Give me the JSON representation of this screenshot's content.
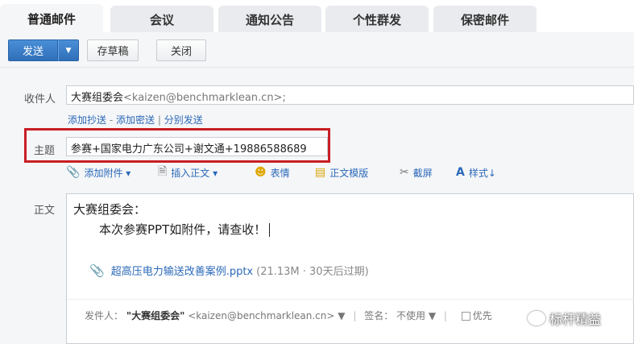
{
  "tabs": [
    {
      "label": "普通邮件",
      "active": true
    },
    {
      "label": "会议",
      "active": false
    },
    {
      "label": "通知公告",
      "active": false
    },
    {
      "label": "个性群发",
      "active": false
    },
    {
      "label": "保密邮件",
      "active": false
    }
  ],
  "toolbar": {
    "send": "发送",
    "send_dropdown": "▼",
    "draft": "存草稿",
    "close": "关闭"
  },
  "recipient": {
    "label": "收件人",
    "name": "大赛组委会",
    "address": "<kaizen@benchmarklean.cn>;"
  },
  "recipient_links": {
    "cc": "添加抄送",
    "dash": "-",
    "bcc": "添加密送",
    "divider": "|",
    "separate": "分别发送"
  },
  "subject": {
    "label": "主题",
    "value": "参赛+国家电力广东公司+谢文通+19886588689"
  },
  "editor_toolbar": {
    "attach": "添加附件 ▾",
    "insert": "插入正文 ▾",
    "emoji": "表情",
    "template": "正文模版",
    "screenshot": "截屏",
    "style": "样式↓"
  },
  "body": {
    "label": "正文",
    "greeting": "大赛组委会：",
    "message": "本次参赛PPT如附件，请查收！",
    "attachment_name": "超高压电力输送改善案例.pptx",
    "attachment_meta": "(21.13M · 30天后过期)"
  },
  "footer": {
    "sender_label": "发件人：",
    "sender_name": "\"大赛组委会\"",
    "sender_address": "<kaizen@benchmarklean.cn> ▼",
    "signature_label": "签名：",
    "signature_value": "不使用 ▼",
    "option": "优先"
  },
  "watermark": "标杆精益",
  "colors": {
    "send_button": "#2f6fb8",
    "highlight_box": "#c81e24",
    "link": "#2a68b8"
  }
}
